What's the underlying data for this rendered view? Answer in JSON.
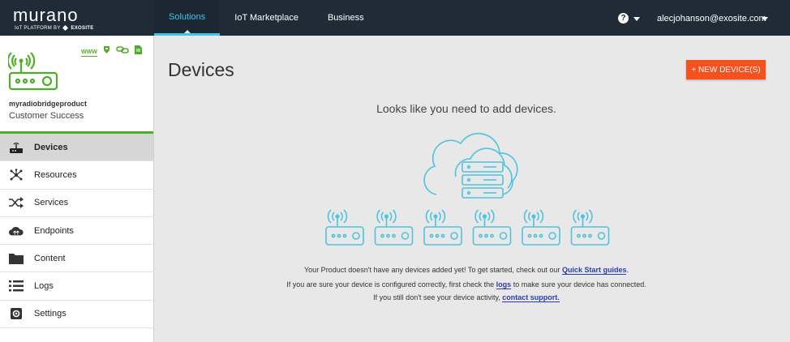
{
  "brand": {
    "name": "murano",
    "tagline": "IoT PLATFORM BY",
    "company": "EXOSITE"
  },
  "nav": {
    "tabs": [
      {
        "label": "Solutions",
        "active": true
      },
      {
        "label": "IoT Marketplace"
      },
      {
        "label": "Business"
      }
    ]
  },
  "account": {
    "help_glyph": "?",
    "email": "alecjohanson@exosite.com"
  },
  "product": {
    "name": "myradiobridgeproduct",
    "team": "Customer Success",
    "badges": [
      "WWW"
    ]
  },
  "sidebar": {
    "items": [
      {
        "label": "Devices",
        "icon": "router-icon",
        "active": true
      },
      {
        "label": "Resources",
        "icon": "resources-icon"
      },
      {
        "label": "Services",
        "icon": "shuffle-icon"
      },
      {
        "label": "Endpoints",
        "icon": "cloud-icon"
      },
      {
        "label": "Content",
        "icon": "folder-icon"
      },
      {
        "label": "Logs",
        "icon": "list-icon"
      },
      {
        "label": "Settings",
        "icon": "gear-icon"
      }
    ]
  },
  "main": {
    "title": "Devices",
    "new_button": "+ NEW DEVICE(S)",
    "empty_title": "Looks like you need to add devices.",
    "line1": {
      "text": "Your Product doesn't have any devices added yet!  To get started, check out our ",
      "link": "Quick Start guides",
      "end": "."
    },
    "line2": {
      "text": "If you are sure your device is configured correctly, first check the ",
      "link": "logs",
      "end": " to make sure your device has connected."
    },
    "line3": {
      "text": "If you still don't see your device activity, ",
      "link": "contact support."
    }
  },
  "colors": {
    "topbar": "#1f2c38",
    "accent": "#3dc6e8",
    "green": "#4caf26",
    "orange": "#f4511e",
    "link": "#2d3bb5",
    "illustration": "#4ec3e0"
  }
}
